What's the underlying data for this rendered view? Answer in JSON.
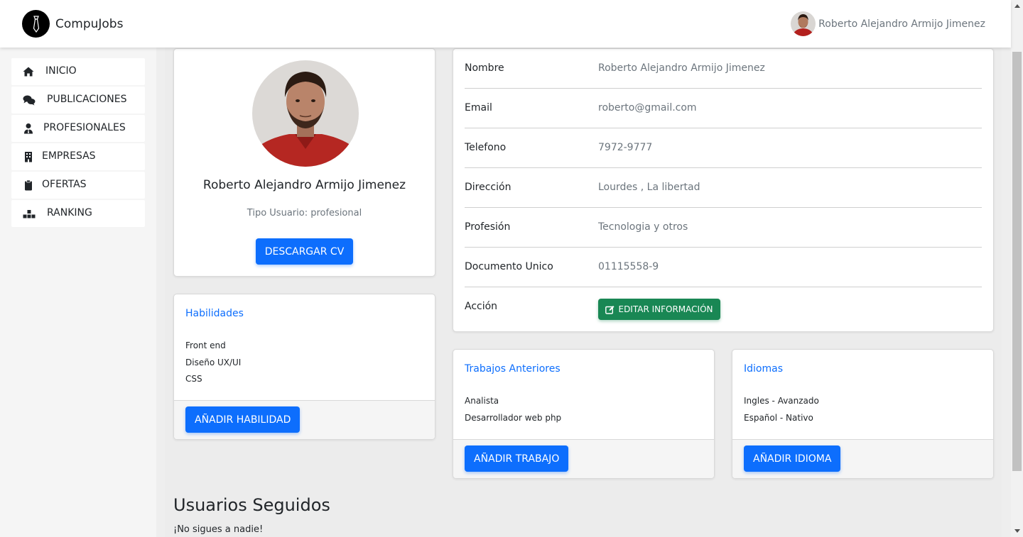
{
  "navbar": {
    "brand": "CompuJobs",
    "user_name": "Roberto Alejandro Armijo Jimenez"
  },
  "sidebar": {
    "items": [
      {
        "label": "INICIO",
        "icon": "home-icon"
      },
      {
        "label": "PUBLICACIONES",
        "icon": "comments-icon"
      },
      {
        "label": "PROFESIONALES",
        "icon": "user-tie-icon"
      },
      {
        "label": "EMPRESAS",
        "icon": "building-icon"
      },
      {
        "label": "OFERTAS",
        "icon": "clipboard-icon"
      },
      {
        "label": "RANKING",
        "icon": "ranking-icon"
      }
    ]
  },
  "profile": {
    "name": "Roberto Alejandro Armijo Jimenez",
    "type_label": "Tipo Usuario: profesional",
    "download_button": "DESCARGAR CV"
  },
  "info": {
    "rows": [
      {
        "key": "Nombre",
        "value": "Roberto Alejandro Armijo Jimenez"
      },
      {
        "key": "Email",
        "value": "roberto@gmail.com"
      },
      {
        "key": "Telefono",
        "value": "7972-9777"
      },
      {
        "key": "Dirección",
        "value": "Lourdes , La libertad"
      },
      {
        "key": "Profesión",
        "value": "Tecnologia y otros"
      },
      {
        "key": "Documento Unico",
        "value": "01115558-9"
      }
    ],
    "action_label": "Acción",
    "edit_button": "EDITAR INFORMACIÓN"
  },
  "skills": {
    "title": "Habilidades",
    "items": [
      "Front end",
      "Diseño UX/UI",
      "CSS"
    ],
    "add_button": "AÑADIR HABILIDAD"
  },
  "jobs": {
    "title": "Trabajos Anteriores",
    "items": [
      "Analista",
      "Desarrollador web php"
    ],
    "add_button": "AÑADIR TRABAJO"
  },
  "languages": {
    "title": "Idiomas",
    "items": [
      "Ingles - Avanzado",
      "Español - Nativo"
    ],
    "add_button": "AÑADIR IDIOMA"
  },
  "followed": {
    "title": "Usuarios Seguidos",
    "empty_text": "¡No sigues a nadie!"
  },
  "colors": {
    "primary": "#0d6efd",
    "success": "#198754",
    "link_title": "#0d6efd",
    "muted": "#6c757d"
  }
}
